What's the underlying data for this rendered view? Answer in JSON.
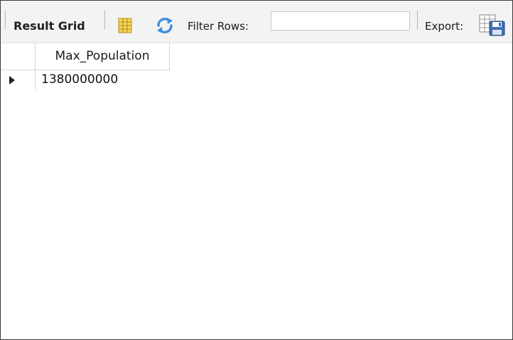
{
  "toolbar": {
    "result_grid_label": "Result Grid",
    "filter_label": "Filter Rows:",
    "filter_value": "",
    "export_label": "Export:",
    "icons": [
      "columns-icon",
      "refresh-icon",
      "export-grid-icon"
    ]
  },
  "grid": {
    "columns": [
      "Max_Population"
    ],
    "rows": [
      [
        "1380000000"
      ]
    ]
  },
  "colors": {
    "toolbar_bg": "#f3f3f3",
    "refresh_blue": "#3d8ed8",
    "grid_border": "#d6d6d6"
  }
}
